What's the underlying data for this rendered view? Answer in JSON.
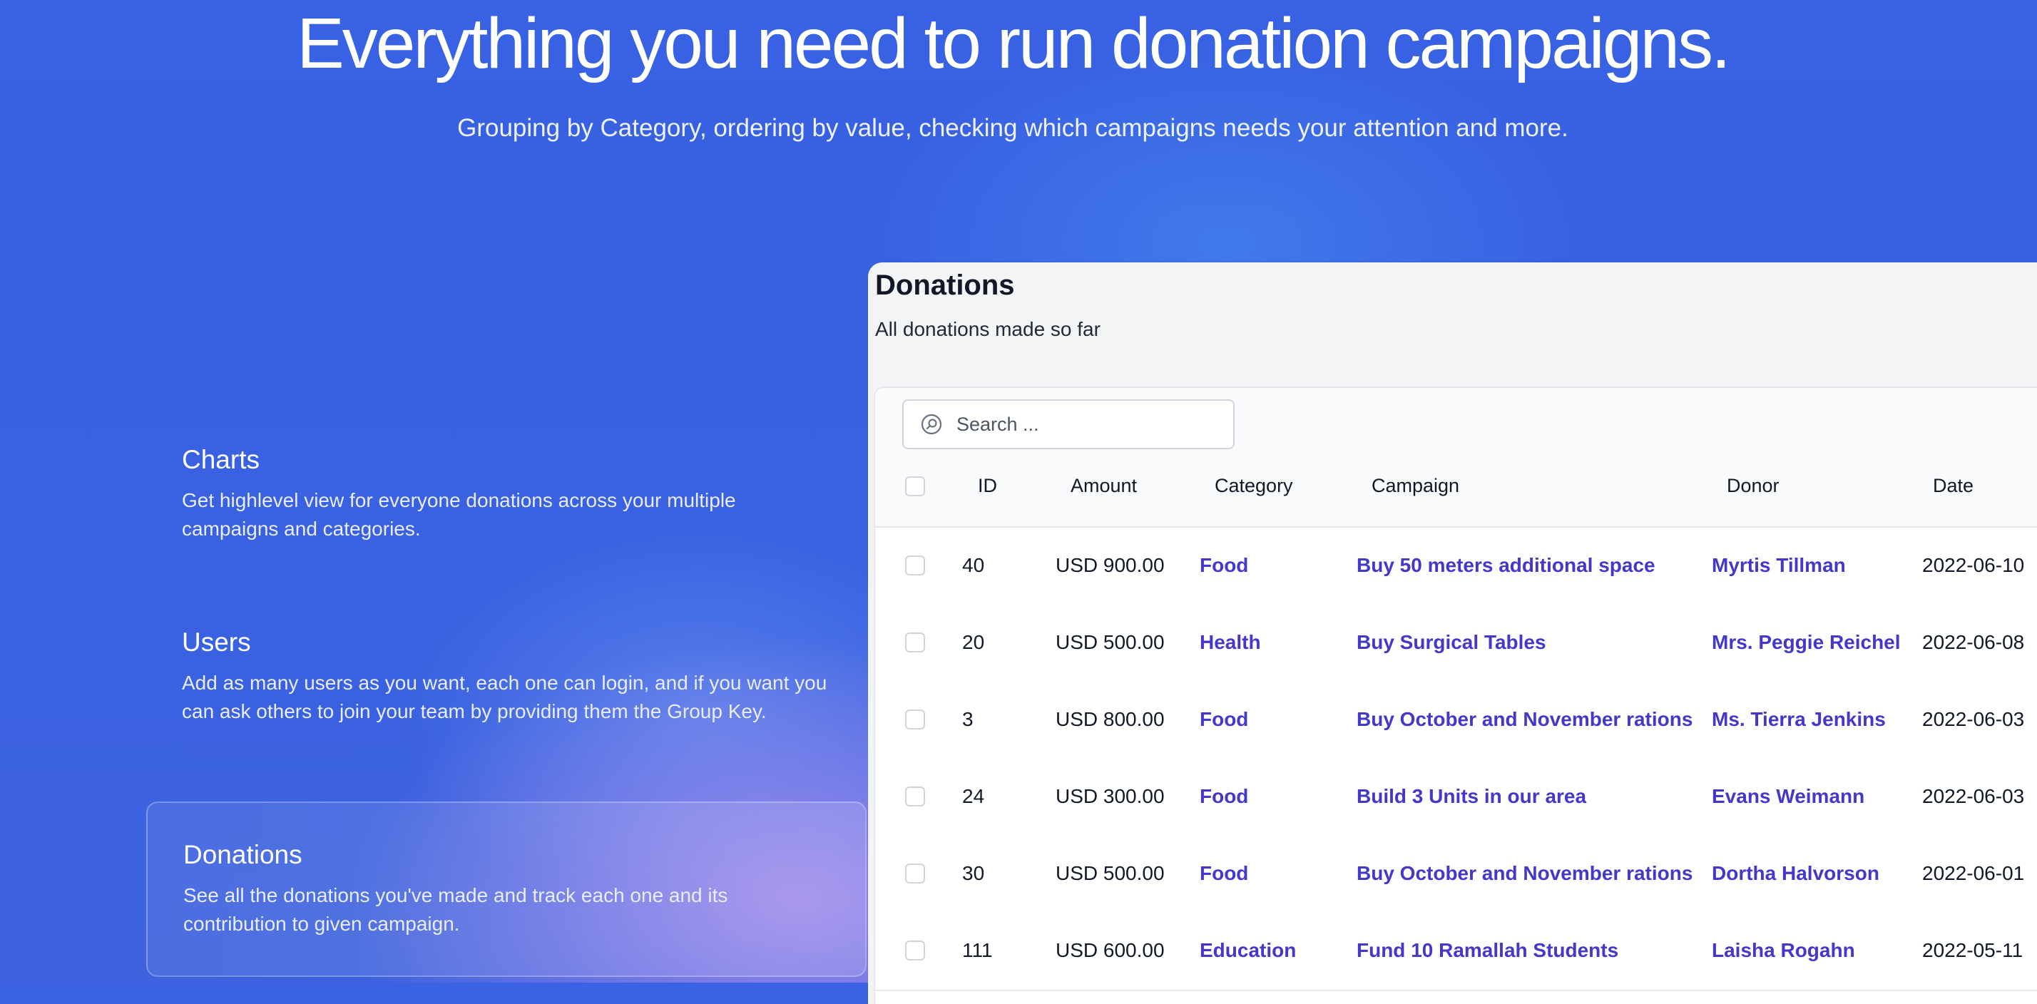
{
  "hero": {
    "title": "Everything you need to run donation campaigns.",
    "subtitle": "Grouping by Category, ordering by value, checking which campaigns needs your attention and more."
  },
  "features": [
    {
      "title": "Charts",
      "description": "Get highlevel view for everyone donations across your multiple campaigns and categories."
    },
    {
      "title": "Users",
      "description": "Add as many users as you want, each one can login, and if you want you can ask others to join your team by providing them the Group Key."
    },
    {
      "title": "Donations",
      "description": "See all the donations you've made and track each one and its contribution to given campaign."
    }
  ],
  "panel": {
    "title": "Donations",
    "subtitle": "All donations made so far",
    "search": {
      "placeholder": "Search ..."
    },
    "columns": [
      "ID",
      "Amount",
      "Category",
      "Campaign",
      "Donor",
      "Date"
    ],
    "rows": [
      {
        "id": "40",
        "amount": "USD 900.00",
        "category": "Food",
        "campaign": "Buy 50 meters additional space",
        "donor": "Myrtis Tillman",
        "date": "2022-06-10"
      },
      {
        "id": "20",
        "amount": "USD 500.00",
        "category": "Health",
        "campaign": "Buy Surgical Tables",
        "donor": "Mrs. Peggie Reichel",
        "date": "2022-06-08"
      },
      {
        "id": "3",
        "amount": "USD 800.00",
        "category": "Food",
        "campaign": "Buy October and November rations",
        "donor": "Ms. Tierra Jenkins",
        "date": "2022-06-03"
      },
      {
        "id": "24",
        "amount": "USD 300.00",
        "category": "Food",
        "campaign": "Build 3 Units in our area",
        "donor": "Evans Weimann",
        "date": "2022-06-03"
      },
      {
        "id": "30",
        "amount": "USD 500.00",
        "category": "Food",
        "campaign": "Buy October and November rations",
        "donor": "Dortha Halvorson",
        "date": "2022-06-01"
      },
      {
        "id": "111",
        "amount": "USD 600.00",
        "category": "Education",
        "campaign": "Fund 10 Ramallah Students",
        "donor": "Laisha Rogahn",
        "date": "2022-05-11"
      }
    ]
  }
}
